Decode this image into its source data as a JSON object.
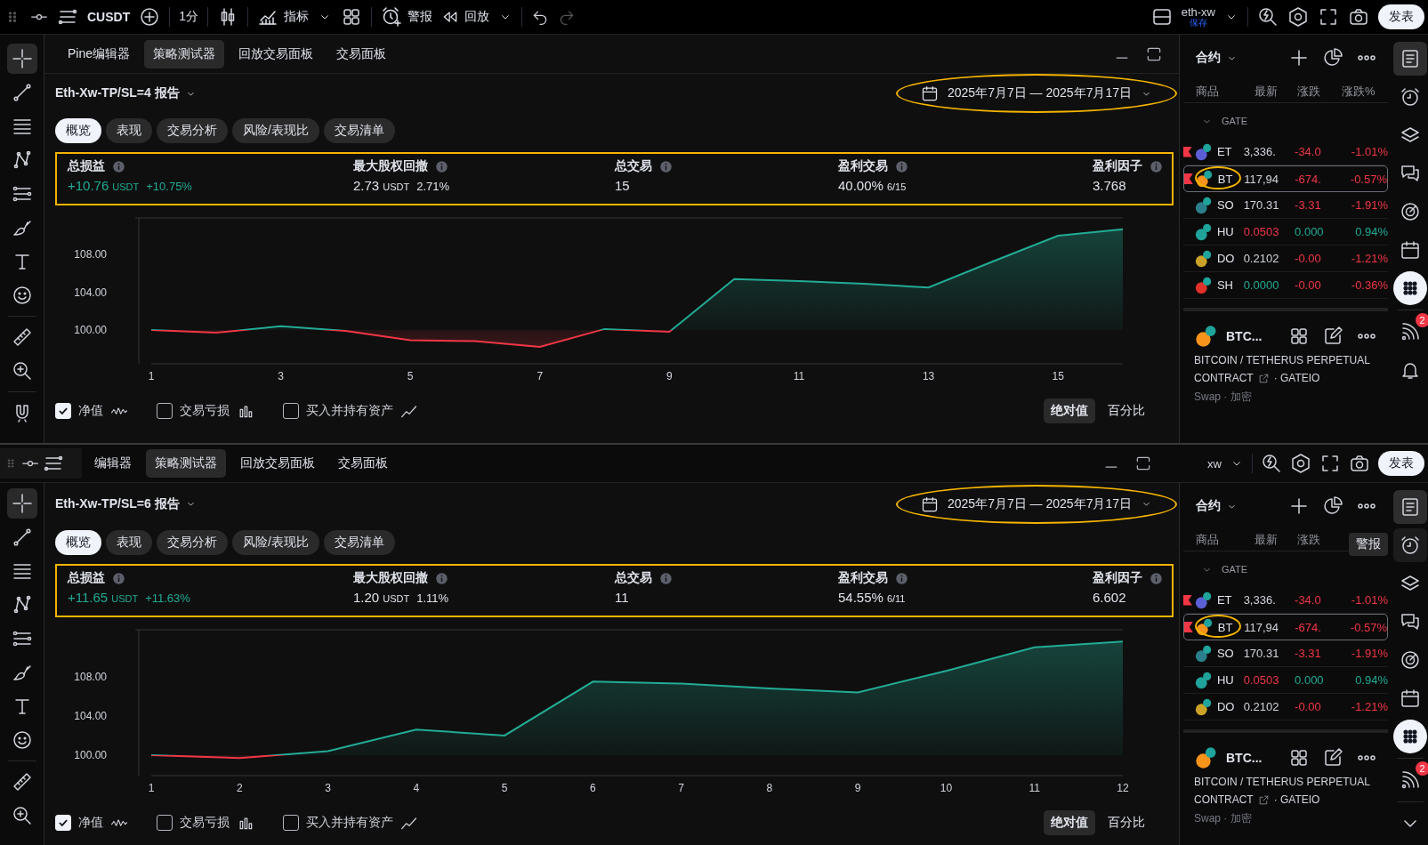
{
  "toolbar": {
    "symbol": "CUSDT",
    "interval": "1分",
    "indicators": "指标",
    "alert": "警报",
    "replay": "回放",
    "account": "eth-xw",
    "save_status": "保存",
    "publish": "发表"
  },
  "panes": [
    {
      "tabs": [
        {
          "label": "Pine编辑器",
          "selected": false
        },
        {
          "label": "策略测试器",
          "selected": true
        },
        {
          "label": "回放交易面板",
          "selected": false
        },
        {
          "label": "交易面板",
          "selected": false
        }
      ],
      "report_title": "Eth-Xw-TP/SL=4 报告",
      "date_range": {
        "label": "2025年7月7日 — 2025年7月17日",
        "highlighted": true
      },
      "subtabs": [
        {
          "label": "概览",
          "selected": true
        },
        {
          "label": "表现",
          "selected": false
        },
        {
          "label": "交易分析",
          "selected": false
        },
        {
          "label": "风险/表现比",
          "selected": false
        },
        {
          "label": "交易清单",
          "selected": false
        }
      ],
      "stats": {
        "highlighted": true,
        "items": [
          {
            "label": "总损益",
            "value": "+10.76",
            "unit": "USDT",
            "detail": "+10.75%",
            "color": "#22ab94"
          },
          {
            "label": "最大股权回撤",
            "value": "2.73",
            "unit": "USDT",
            "detail": "2.71%",
            "color": "#e0e3eb"
          },
          {
            "label": "总交易",
            "value": "15",
            "color": "#e0e3eb"
          },
          {
            "label": "盈利交易",
            "value": "40.00%",
            "unit": "6/15",
            "color": "#e0e3eb"
          },
          {
            "label": "盈利因子",
            "value": "3.768",
            "color": "#e0e3eb"
          }
        ]
      },
      "chart_data": {
        "type": "area",
        "x": [
          1,
          2,
          3,
          4,
          5,
          6,
          7,
          8,
          9,
          10,
          11,
          12,
          13,
          14,
          15,
          16
        ],
        "xticks": [
          1,
          3,
          5,
          7,
          9,
          11,
          13,
          15
        ],
        "xlim": [
          1,
          16
        ],
        "ylim": [
          96.4,
          111.9
        ],
        "yticks": [
          {
            "value": 100,
            "label": "100.00"
          },
          {
            "value": 104,
            "label": "104.00"
          },
          {
            "value": 108,
            "label": "108.00"
          }
        ],
        "series": [
          {
            "color": "#22ab94",
            "values": [
              100.0,
              99.7,
              100.4,
              99.9,
              98.9,
              98.8,
              98.2,
              100.1,
              99.8,
              105.4,
              105.2,
              104.9,
              104.5,
              107.3,
              110.0,
              110.7
            ]
          }
        ]
      },
      "legend": [
        {
          "label": "净值",
          "checked": true,
          "kind": "wave"
        },
        {
          "label": "交易亏损",
          "checked": false,
          "kind": "bars"
        },
        {
          "label": "买入并持有资产",
          "checked": false,
          "kind": "line"
        }
      ],
      "scale_toggle": [
        {
          "label": "绝对值",
          "selected": true
        },
        {
          "label": "百分比",
          "selected": false
        }
      ],
      "tools": [
        {
          "kind": "crosshair",
          "selected": true
        },
        {
          "kind": "line",
          "selected": false
        },
        {
          "kind": "fib",
          "selected": false
        },
        {
          "kind": "pattern",
          "selected": false
        },
        {
          "kind": "multiline",
          "selected": false
        },
        {
          "kind": "brush",
          "selected": false
        },
        {
          "kind": "text",
          "selected": false
        },
        {
          "kind": "emoji",
          "selected": false
        },
        {
          "kind": "ruler",
          "selected": false
        },
        {
          "kind": "zoom",
          "selected": false
        },
        {
          "kind": "magnet",
          "selected": false
        }
      ],
      "watchlist": {
        "title": "合约",
        "columns": [
          "商品",
          "最新",
          "涨跌",
          "涨跌%"
        ],
        "group": "GATE",
        "rows": [
          {
            "symbol": "ET",
            "price": {
              "text": "3,336.",
              "color": "#d1d4dc"
            },
            "change": {
              "text": "-34.0",
              "color": "#f23645"
            },
            "percent": {
              "text": "-1.01%",
              "color": "#f23645"
            },
            "color": "#5b5fd6",
            "flagged": true,
            "selected": false,
            "highlighted": false
          },
          {
            "symbol": "BT",
            "price": {
              "text": "117,94",
              "color": "#d1d4dc"
            },
            "change": {
              "text": "-674.",
              "color": "#f23645"
            },
            "percent": {
              "text": "-0.57%",
              "color": "#f23645"
            },
            "color": "#f7931a",
            "flagged": true,
            "selected": true,
            "highlighted": true
          },
          {
            "symbol": "SO",
            "price": {
              "text": "170.31",
              "color": "#d1d4dc"
            },
            "change": {
              "text": "-3.31",
              "color": "#f23645"
            },
            "percent": {
              "text": "-1.91%",
              "color": "#f23645"
            },
            "color": "#2b7f8a",
            "flagged": false,
            "selected": false,
            "highlighted": false
          },
          {
            "symbol": "HU",
            "price": {
              "text": "0.0503",
              "color": "#f23645"
            },
            "change": {
              "text": "0.000",
              "color": "#22ab94"
            },
            "percent": {
              "text": "0.94%",
              "color": "#22ab94"
            },
            "color": "#1fa39b",
            "flagged": false,
            "selected": false,
            "highlighted": false
          },
          {
            "symbol": "DO",
            "price": {
              "text": "0.2102",
              "color": "#d1d4dc"
            },
            "change": {
              "text": "-0.00",
              "color": "#f23645"
            },
            "percent": {
              "text": "-1.21%",
              "color": "#f23645"
            },
            "color": "#c9a227",
            "flagged": false,
            "selected": false,
            "highlighted": false
          },
          {
            "symbol": "SH",
            "price": {
              "text": "0.0000",
              "color": "#22ab94"
            },
            "change": {
              "text": "-0.00",
              "color": "#f23645"
            },
            "percent": {
              "text": "-0.36%",
              "color": "#f23645"
            },
            "color": "#e0302a",
            "flagged": false,
            "selected": false,
            "highlighted": false
          }
        ],
        "symbol": {
          "short": "BTC...",
          "name": "BITCOIN / TETHERUS PERPETUAL",
          "kind": "CONTRACT",
          "exchange": "· GATEIO",
          "meta": "Swap · 加密"
        }
      },
      "sidebar": [
        {
          "kind": "watchlist",
          "selected": true
        },
        {
          "kind": "alarm",
          "selected": false
        },
        {
          "kind": "layers",
          "selected": false
        },
        {
          "kind": "chat",
          "selected": false
        },
        {
          "kind": "target",
          "selected": false
        },
        {
          "kind": "calendar",
          "selected": false
        },
        {
          "kind": "apps",
          "selected": false
        },
        {
          "kind": "rss",
          "selected": false,
          "badge": "2"
        },
        {
          "kind": "bell",
          "selected": false
        }
      ]
    },
    {
      "toolbar_fragment": {
        "account": "xw",
        "publish": "发表"
      },
      "tabs": [
        {
          "label": "编辑器",
          "selected": false
        },
        {
          "label": "策略测试器",
          "selected": true
        },
        {
          "label": "回放交易面板",
          "selected": false
        },
        {
          "label": "交易面板",
          "selected": false
        }
      ],
      "report_title": "Eth-Xw-TP/SL=6 报告",
      "date_range": {
        "label": "2025年7月7日 — 2025年7月17日",
        "highlighted": true
      },
      "subtabs": [
        {
          "label": "概览",
          "selected": true
        },
        {
          "label": "表现",
          "selected": false
        },
        {
          "label": "交易分析",
          "selected": false
        },
        {
          "label": "风险/表现比",
          "selected": false
        },
        {
          "label": "交易清单",
          "selected": false
        }
      ],
      "stats": {
        "highlighted": true,
        "items": [
          {
            "label": "总损益",
            "value": "+11.65",
            "unit": "USDT",
            "detail": "+11.63%",
            "color": "#22ab94"
          },
          {
            "label": "最大股权回撤",
            "value": "1.20",
            "unit": "USDT",
            "detail": "1.11%",
            "color": "#e0e3eb"
          },
          {
            "label": "总交易",
            "value": "11",
            "color": "#e0e3eb"
          },
          {
            "label": "盈利交易",
            "value": "54.55%",
            "unit": "6/11",
            "color": "#e0e3eb"
          },
          {
            "label": "盈利因子",
            "value": "6.602",
            "color": "#e0e3eb"
          }
        ]
      },
      "chart_data": {
        "type": "area",
        "x": [
          1,
          2,
          3,
          4,
          5,
          6,
          7,
          8,
          9,
          10,
          11,
          12
        ],
        "xticks": [
          1,
          2,
          3,
          4,
          5,
          6,
          7,
          8,
          9,
          10,
          11,
          12
        ],
        "xlim": [
          1,
          12
        ],
        "ylim": [
          97.9,
          112.8
        ],
        "yticks": [
          {
            "value": 100,
            "label": "100.00"
          },
          {
            "value": 104,
            "label": "104.00"
          },
          {
            "value": 108,
            "label": "108.00"
          }
        ],
        "series": [
          {
            "color": "#22ab94",
            "values": [
              100.0,
              99.7,
              100.4,
              102.6,
              102.0,
              107.5,
              107.3,
              106.8,
              106.4,
              108.6,
              111.0,
              111.6
            ]
          }
        ]
      },
      "legend": [
        {
          "label": "净值",
          "checked": true,
          "kind": "wave"
        },
        {
          "label": "交易亏损",
          "checked": false,
          "kind": "bars"
        },
        {
          "label": "买入并持有资产",
          "checked": false,
          "kind": "line"
        }
      ],
      "scale_toggle": [
        {
          "label": "绝对值",
          "selected": true
        },
        {
          "label": "百分比",
          "selected": false
        }
      ],
      "tools": [
        {
          "kind": "crosshair",
          "selected": true
        },
        {
          "kind": "line",
          "selected": false
        },
        {
          "kind": "fib",
          "selected": false
        },
        {
          "kind": "pattern",
          "selected": false
        },
        {
          "kind": "multiline",
          "selected": false
        },
        {
          "kind": "brush",
          "selected": false
        },
        {
          "kind": "text",
          "selected": false
        },
        {
          "kind": "emoji",
          "selected": false
        },
        {
          "kind": "ruler",
          "selected": false
        },
        {
          "kind": "zoom",
          "selected": false
        }
      ],
      "watchlist": {
        "title": "合约",
        "columns": [
          "商品",
          "最新",
          "涨跌"
        ],
        "group": "GATE",
        "rows": [
          {
            "symbol": "ET",
            "price": {
              "text": "3,336.",
              "color": "#d1d4dc"
            },
            "change": {
              "text": "-34.0",
              "color": "#f23645"
            },
            "percent": {
              "text": "-1.01%",
              "color": "#f23645"
            },
            "color": "#5b5fd6",
            "flagged": true,
            "selected": false,
            "highlighted": false
          },
          {
            "symbol": "BT",
            "price": {
              "text": "117,94",
              "color": "#d1d4dc"
            },
            "change": {
              "text": "-674.",
              "color": "#f23645"
            },
            "percent": {
              "text": "-0.57%",
              "color": "#f23645"
            },
            "color": "#f7931a",
            "flagged": true,
            "selected": true,
            "highlighted": true
          },
          {
            "symbol": "SO",
            "price": {
              "text": "170.31",
              "color": "#d1d4dc"
            },
            "change": {
              "text": "-3.31",
              "color": "#f23645"
            },
            "percent": {
              "text": "-1.91%",
              "color": "#f23645"
            },
            "color": "#2b7f8a",
            "flagged": false,
            "selected": false,
            "highlighted": false
          },
          {
            "symbol": "HU",
            "price": {
              "text": "0.0503",
              "color": "#f23645"
            },
            "change": {
              "text": "0.000",
              "color": "#22ab94"
            },
            "percent": {
              "text": "0.94%",
              "color": "#22ab94"
            },
            "color": "#1fa39b",
            "flagged": false,
            "selected": false,
            "highlighted": false
          },
          {
            "symbol": "DO",
            "price": {
              "text": "0.2102",
              "color": "#d1d4dc"
            },
            "change": {
              "text": "-0.00",
              "color": "#f23645"
            },
            "percent": {
              "text": "-1.21%",
              "color": "#f23645"
            },
            "color": "#c9a227",
            "flagged": false,
            "selected": false,
            "highlighted": false
          }
        ],
        "symbol": {
          "short": "BTC...",
          "name": "BITCOIN / TETHERUS PERPETUAL",
          "kind": "CONTRACT",
          "exchange": "· GATEIO",
          "meta": "Swap · 加密"
        }
      },
      "sidebar": [
        {
          "kind": "watchlist",
          "selected": true
        },
        {
          "kind": "alarm",
          "selected": false,
          "tooltip": "警报"
        },
        {
          "kind": "layers",
          "selected": false
        },
        {
          "kind": "chat",
          "selected": false
        },
        {
          "kind": "target",
          "selected": false
        },
        {
          "kind": "calendar",
          "selected": false
        },
        {
          "kind": "apps",
          "selected": false
        },
        {
          "kind": "rss",
          "selected": false,
          "badge": "2"
        },
        {
          "kind": "scroll",
          "selected": false
        }
      ]
    }
  ]
}
